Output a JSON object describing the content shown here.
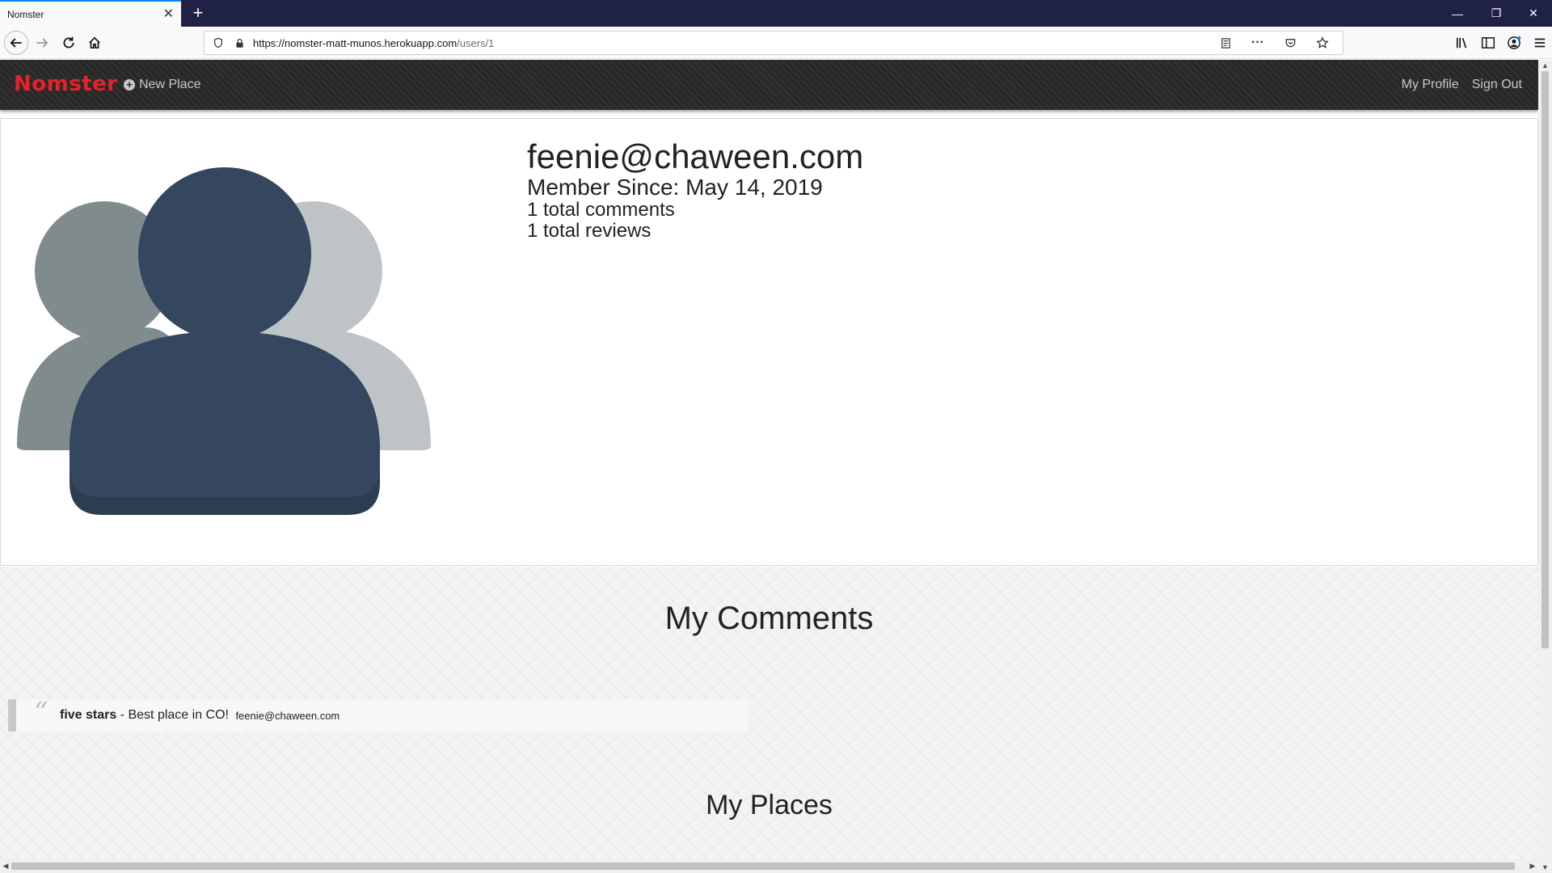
{
  "browser": {
    "tab_title": "Nomster",
    "url_host": "https://nomster-matt-munos.herokuapp.com",
    "url_path": "/users/1"
  },
  "site": {
    "brand": "Nomster",
    "new_place": "New Place",
    "my_profile": "My Profile",
    "sign_out": "Sign Out"
  },
  "profile": {
    "email": "feenie@chaween.com",
    "member_since": "Member Since: May 14, 2019",
    "total_comments": "1 total comments",
    "total_reviews": "1 total reviews"
  },
  "comments": {
    "title": "My Comments",
    "items": [
      {
        "rating": "five stars",
        "text": " - Best place in CO! ",
        "user": "feenie@chaween.com"
      }
    ]
  },
  "places": {
    "title": "My Places"
  },
  "colors": {
    "brand": "#e8212a",
    "avatar_front": "#34475e",
    "avatar_left": "#7f8b8d",
    "avatar_right": "#bdc3c7"
  }
}
